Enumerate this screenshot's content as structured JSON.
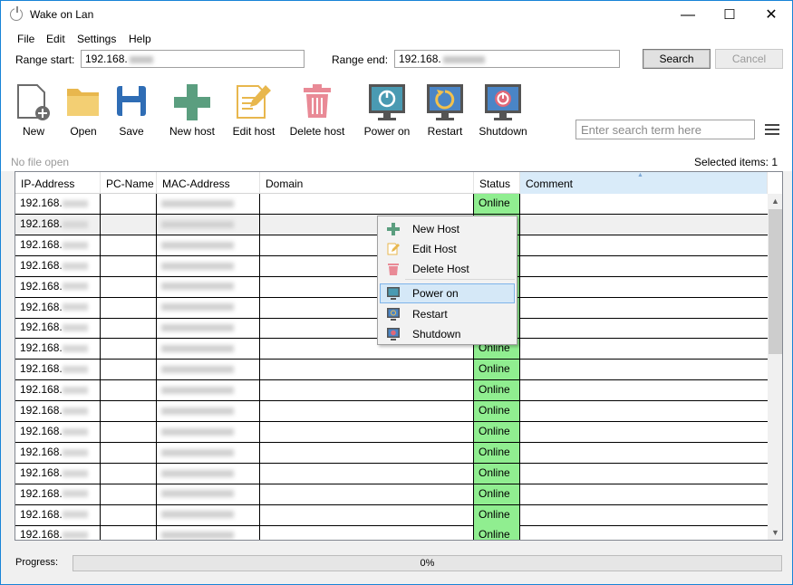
{
  "window": {
    "title": "Wake on Lan",
    "controls": {
      "minimize": "—",
      "maximize": "☐",
      "close": "✕"
    }
  },
  "menu": [
    "File",
    "Edit",
    "Settings",
    "Help"
  ],
  "range": {
    "start_label": "Range start:",
    "start_value": "192.168.",
    "end_label": "Range end:",
    "end_value": "192.168."
  },
  "buttons": {
    "search": "Search",
    "cancel": "Cancel"
  },
  "toolbar": [
    {
      "label": "New",
      "icon": "new-file-icon"
    },
    {
      "label": "Open",
      "icon": "folder-icon"
    },
    {
      "label": "Save",
      "icon": "floppy-icon"
    },
    {
      "label": "New host",
      "icon": "plus-icon"
    },
    {
      "label": "Edit host",
      "icon": "edit-icon"
    },
    {
      "label": "Delete host",
      "icon": "trash-icon"
    },
    {
      "label": "Power on",
      "icon": "power-on-monitor-icon"
    },
    {
      "label": "Restart",
      "icon": "restart-monitor-icon"
    },
    {
      "label": "Shutdown",
      "icon": "shutdown-monitor-icon"
    }
  ],
  "search": {
    "placeholder": "Enter search term here"
  },
  "status": {
    "file": "No file open",
    "selected": "Selected items: 1"
  },
  "table": {
    "columns": [
      "IP-Address",
      "PC-Name",
      "MAC-Address",
      "Domain",
      "Status",
      "Comment"
    ],
    "rows": [
      {
        "ip": "192.168.",
        "status": "Online"
      },
      {
        "ip": "192.168.",
        "status": "Online"
      },
      {
        "ip": "192.168.",
        "status": "Online"
      },
      {
        "ip": "192.168.",
        "status": "Online"
      },
      {
        "ip": "192.168.",
        "status": "Online"
      },
      {
        "ip": "192.168.",
        "status": "Online"
      },
      {
        "ip": "192.168.",
        "status": "Online"
      },
      {
        "ip": "192.168.",
        "status": "Online"
      },
      {
        "ip": "192.168.",
        "status": "Online"
      },
      {
        "ip": "192.168.",
        "status": "Online"
      },
      {
        "ip": "192.168.",
        "status": "Online"
      },
      {
        "ip": "192.168.",
        "status": "Online"
      },
      {
        "ip": "192.168.",
        "status": "Online"
      },
      {
        "ip": "192.168.",
        "status": "Online"
      },
      {
        "ip": "192.168.",
        "status": "Online"
      },
      {
        "ip": "192.168.",
        "status": "Online"
      },
      {
        "ip": "192.168.",
        "status": "Online"
      }
    ]
  },
  "context_menu": [
    {
      "label": "New Host",
      "icon": "plus-icon"
    },
    {
      "label": "Edit Host",
      "icon": "edit-icon"
    },
    {
      "label": "Delete Host",
      "icon": "trash-icon"
    },
    {
      "label": "Power on",
      "icon": "power-on-monitor-icon"
    },
    {
      "label": "Restart",
      "icon": "restart-monitor-icon"
    },
    {
      "label": "Shutdown",
      "icon": "shutdown-monitor-icon"
    }
  ],
  "progress": {
    "label": "Progress:",
    "value": 0,
    "text": "0%"
  },
  "colors": {
    "online": "#90ee90",
    "accent": "#1883d7",
    "selection": "#d5e8f7"
  }
}
